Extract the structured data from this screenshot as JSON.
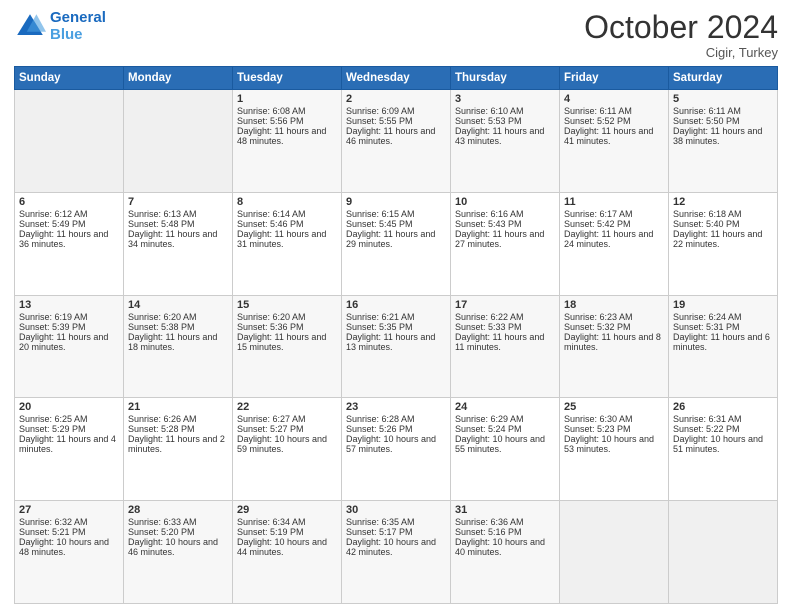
{
  "header": {
    "logo_line1": "General",
    "logo_line2": "Blue",
    "month": "October 2024",
    "location": "Cigir, Turkey"
  },
  "days_of_week": [
    "Sunday",
    "Monday",
    "Tuesday",
    "Wednesday",
    "Thursday",
    "Friday",
    "Saturday"
  ],
  "weeks": [
    [
      {
        "day": "",
        "info": ""
      },
      {
        "day": "",
        "info": ""
      },
      {
        "day": "1",
        "info": "Sunrise: 6:08 AM\nSunset: 5:56 PM\nDaylight: 11 hours and 48 minutes."
      },
      {
        "day": "2",
        "info": "Sunrise: 6:09 AM\nSunset: 5:55 PM\nDaylight: 11 hours and 46 minutes."
      },
      {
        "day": "3",
        "info": "Sunrise: 6:10 AM\nSunset: 5:53 PM\nDaylight: 11 hours and 43 minutes."
      },
      {
        "day": "4",
        "info": "Sunrise: 6:11 AM\nSunset: 5:52 PM\nDaylight: 11 hours and 41 minutes."
      },
      {
        "day": "5",
        "info": "Sunrise: 6:11 AM\nSunset: 5:50 PM\nDaylight: 11 hours and 38 minutes."
      }
    ],
    [
      {
        "day": "6",
        "info": "Sunrise: 6:12 AM\nSunset: 5:49 PM\nDaylight: 11 hours and 36 minutes."
      },
      {
        "day": "7",
        "info": "Sunrise: 6:13 AM\nSunset: 5:48 PM\nDaylight: 11 hours and 34 minutes."
      },
      {
        "day": "8",
        "info": "Sunrise: 6:14 AM\nSunset: 5:46 PM\nDaylight: 11 hours and 31 minutes."
      },
      {
        "day": "9",
        "info": "Sunrise: 6:15 AM\nSunset: 5:45 PM\nDaylight: 11 hours and 29 minutes."
      },
      {
        "day": "10",
        "info": "Sunrise: 6:16 AM\nSunset: 5:43 PM\nDaylight: 11 hours and 27 minutes."
      },
      {
        "day": "11",
        "info": "Sunrise: 6:17 AM\nSunset: 5:42 PM\nDaylight: 11 hours and 24 minutes."
      },
      {
        "day": "12",
        "info": "Sunrise: 6:18 AM\nSunset: 5:40 PM\nDaylight: 11 hours and 22 minutes."
      }
    ],
    [
      {
        "day": "13",
        "info": "Sunrise: 6:19 AM\nSunset: 5:39 PM\nDaylight: 11 hours and 20 minutes."
      },
      {
        "day": "14",
        "info": "Sunrise: 6:20 AM\nSunset: 5:38 PM\nDaylight: 11 hours and 18 minutes."
      },
      {
        "day": "15",
        "info": "Sunrise: 6:20 AM\nSunset: 5:36 PM\nDaylight: 11 hours and 15 minutes."
      },
      {
        "day": "16",
        "info": "Sunrise: 6:21 AM\nSunset: 5:35 PM\nDaylight: 11 hours and 13 minutes."
      },
      {
        "day": "17",
        "info": "Sunrise: 6:22 AM\nSunset: 5:33 PM\nDaylight: 11 hours and 11 minutes."
      },
      {
        "day": "18",
        "info": "Sunrise: 6:23 AM\nSunset: 5:32 PM\nDaylight: 11 hours and 8 minutes."
      },
      {
        "day": "19",
        "info": "Sunrise: 6:24 AM\nSunset: 5:31 PM\nDaylight: 11 hours and 6 minutes."
      }
    ],
    [
      {
        "day": "20",
        "info": "Sunrise: 6:25 AM\nSunset: 5:29 PM\nDaylight: 11 hours and 4 minutes."
      },
      {
        "day": "21",
        "info": "Sunrise: 6:26 AM\nSunset: 5:28 PM\nDaylight: 11 hours and 2 minutes."
      },
      {
        "day": "22",
        "info": "Sunrise: 6:27 AM\nSunset: 5:27 PM\nDaylight: 10 hours and 59 minutes."
      },
      {
        "day": "23",
        "info": "Sunrise: 6:28 AM\nSunset: 5:26 PM\nDaylight: 10 hours and 57 minutes."
      },
      {
        "day": "24",
        "info": "Sunrise: 6:29 AM\nSunset: 5:24 PM\nDaylight: 10 hours and 55 minutes."
      },
      {
        "day": "25",
        "info": "Sunrise: 6:30 AM\nSunset: 5:23 PM\nDaylight: 10 hours and 53 minutes."
      },
      {
        "day": "26",
        "info": "Sunrise: 6:31 AM\nSunset: 5:22 PM\nDaylight: 10 hours and 51 minutes."
      }
    ],
    [
      {
        "day": "27",
        "info": "Sunrise: 6:32 AM\nSunset: 5:21 PM\nDaylight: 10 hours and 48 minutes."
      },
      {
        "day": "28",
        "info": "Sunrise: 6:33 AM\nSunset: 5:20 PM\nDaylight: 10 hours and 46 minutes."
      },
      {
        "day": "29",
        "info": "Sunrise: 6:34 AM\nSunset: 5:19 PM\nDaylight: 10 hours and 44 minutes."
      },
      {
        "day": "30",
        "info": "Sunrise: 6:35 AM\nSunset: 5:17 PM\nDaylight: 10 hours and 42 minutes."
      },
      {
        "day": "31",
        "info": "Sunrise: 6:36 AM\nSunset: 5:16 PM\nDaylight: 10 hours and 40 minutes."
      },
      {
        "day": "",
        "info": ""
      },
      {
        "day": "",
        "info": ""
      }
    ]
  ]
}
